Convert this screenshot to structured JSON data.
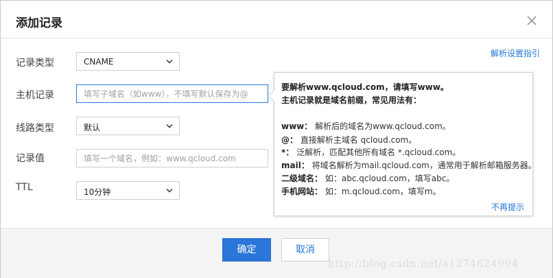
{
  "dialog": {
    "title": "添加记录",
    "guide_link": "解析设置指引"
  },
  "form": {
    "record_type": {
      "label": "记录类型",
      "value": "CNAME"
    },
    "host_record": {
      "label": "主机记录",
      "placeholder": "填写子域名（如www），不填写默认保存为@"
    },
    "line_type": {
      "label": "线路类型",
      "value": "默认"
    },
    "record_value": {
      "label": "记录值",
      "placeholder": "填写一个域名，例如：www.qcloud.com"
    },
    "ttl": {
      "label": "TTL",
      "value": "10分钟"
    }
  },
  "tooltip": {
    "heading1": "要解析www.qcloud.com，请填写www。",
    "heading2": "主机记录就是域名前缀，常见用法有：",
    "items": [
      {
        "key": "www：",
        "text": "解析后的域名为www.qcloud.com。"
      },
      {
        "key": "@：",
        "text": "直接解析主域名 qcloud.com。"
      },
      {
        "key": "*：",
        "text": "泛解析，匹配其他所有域名 *.qcloud.com。"
      },
      {
        "key": "mail：",
        "text": "将域名解析为mail.qcloud.com，通常用于解析邮箱服务器。"
      },
      {
        "key": "二级域名：",
        "text": "如：abc.qcloud.com，填写abc。"
      },
      {
        "key": "手机网站：",
        "text": "如：m.qcloud.com，填写m。"
      }
    ],
    "dismiss": "不再提示"
  },
  "footer": {
    "confirm": "确定",
    "cancel": "取消"
  },
  "watermark": "http://blog.csdn.net/a1274624994",
  "colors": {
    "accent": "#2277da",
    "primary_button": "#2b76d9"
  }
}
